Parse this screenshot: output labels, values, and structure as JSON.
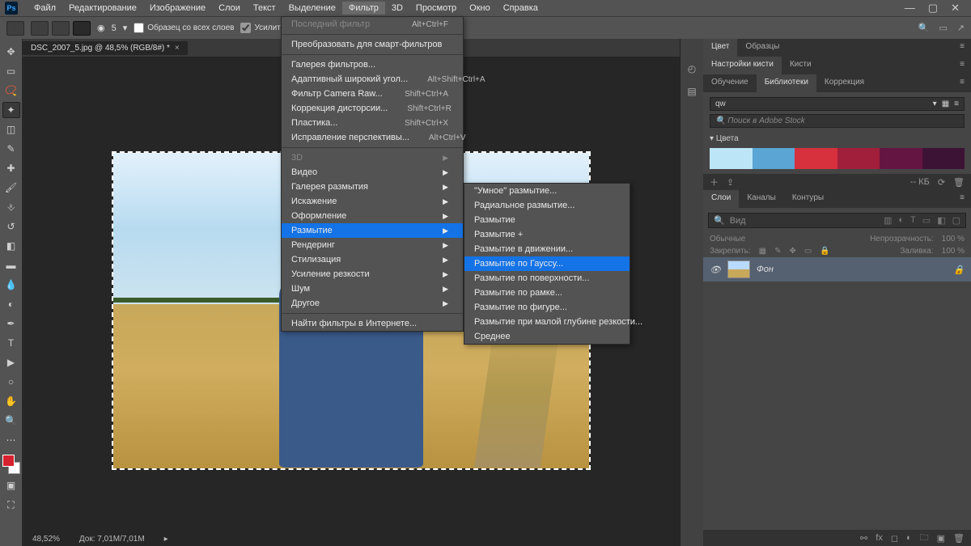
{
  "app": {
    "logo": "Ps"
  },
  "menubar": {
    "items": [
      "Файл",
      "Редактирование",
      "Изображение",
      "Слои",
      "Текст",
      "Выделение",
      "Фильтр",
      "3D",
      "Просмотр",
      "Окно",
      "Справка"
    ],
    "active_index": 6
  },
  "options_bar": {
    "brush_size": "5",
    "sample_all_label": "Образец со всех слоев",
    "enhance_label": "Усилить автомат"
  },
  "document": {
    "tab_title": "DSC_2007_5.jpg @ 48,5% (RGB/8#) *",
    "zoom": "48,52%",
    "doc_size": "Док: 7,01M/7,01M"
  },
  "filter_menu": {
    "items": [
      {
        "label": "Последний фильтр",
        "shortcut": "Alt+Ctrl+F",
        "disabled": true
      },
      {
        "sep": true
      },
      {
        "label": "Преобразовать для смарт-фильтров"
      },
      {
        "sep": true
      },
      {
        "label": "Галерея фильтров..."
      },
      {
        "label": "Адаптивный широкий угол...",
        "shortcut": "Alt+Shift+Ctrl+A"
      },
      {
        "label": "Фильтр Camera Raw...",
        "shortcut": "Shift+Ctrl+A"
      },
      {
        "label": "Коррекция дисторсии...",
        "shortcut": "Shift+Ctrl+R"
      },
      {
        "label": "Пластика...",
        "shortcut": "Shift+Ctrl+X"
      },
      {
        "label": "Исправление перспективы...",
        "shortcut": "Alt+Ctrl+V"
      },
      {
        "sep": true
      },
      {
        "label": "3D",
        "submenu": true,
        "disabled": true
      },
      {
        "label": "Видео",
        "submenu": true
      },
      {
        "label": "Галерея размытия",
        "submenu": true
      },
      {
        "label": "Искажение",
        "submenu": true
      },
      {
        "label": "Оформление",
        "submenu": true
      },
      {
        "label": "Размытие",
        "submenu": true,
        "highlight": true
      },
      {
        "label": "Рендеринг",
        "submenu": true
      },
      {
        "label": "Стилизация",
        "submenu": true
      },
      {
        "label": "Усиление резкости",
        "submenu": true
      },
      {
        "label": "Шум",
        "submenu": true
      },
      {
        "label": "Другое",
        "submenu": true
      },
      {
        "sep": true
      },
      {
        "label": "Найти фильтры в Интернете..."
      }
    ]
  },
  "blur_menu": {
    "items": [
      {
        "label": "\"Умное\" размытие..."
      },
      {
        "label": "Радиальное размытие..."
      },
      {
        "label": "Размытие"
      },
      {
        "label": "Размытие +"
      },
      {
        "label": "Размытие в движении..."
      },
      {
        "label": "Размытие по Гауссу...",
        "highlight": true
      },
      {
        "label": "Размытие по поверхности..."
      },
      {
        "label": "Размытие по рамке..."
      },
      {
        "label": "Размытие по фигуре..."
      },
      {
        "label": "Размытие при малой глубине резкости..."
      },
      {
        "label": "Среднее"
      }
    ]
  },
  "panels": {
    "color_tabs": [
      "Цвет",
      "Образцы"
    ],
    "brush_tabs": [
      "Настройки кисти",
      "Кисти"
    ],
    "learn_tabs": [
      "Обучение",
      "Библиотеки",
      "Коррекция"
    ],
    "library_name": "qw",
    "library_search_ph": "Поиск в Adobe Stock",
    "library_section": "Цвета",
    "lib_kb": "-- КБ",
    "swatches": [
      "#bce6f7",
      "#5aa5d4",
      "#d6313d",
      "#a11f3a",
      "#651541",
      "#3d1335"
    ],
    "layers_tabs": [
      "Слои",
      "Каналы",
      "Контуры"
    ],
    "layer_search_ph": "Вид",
    "blend_label": "Обычные",
    "opacity_label": "Непрозрачность:",
    "opacity_value": "100 %",
    "lock_label": "Закрепить:",
    "fill_label": "Заливка:",
    "fill_value": "100 %",
    "layer_name": "Фон"
  }
}
